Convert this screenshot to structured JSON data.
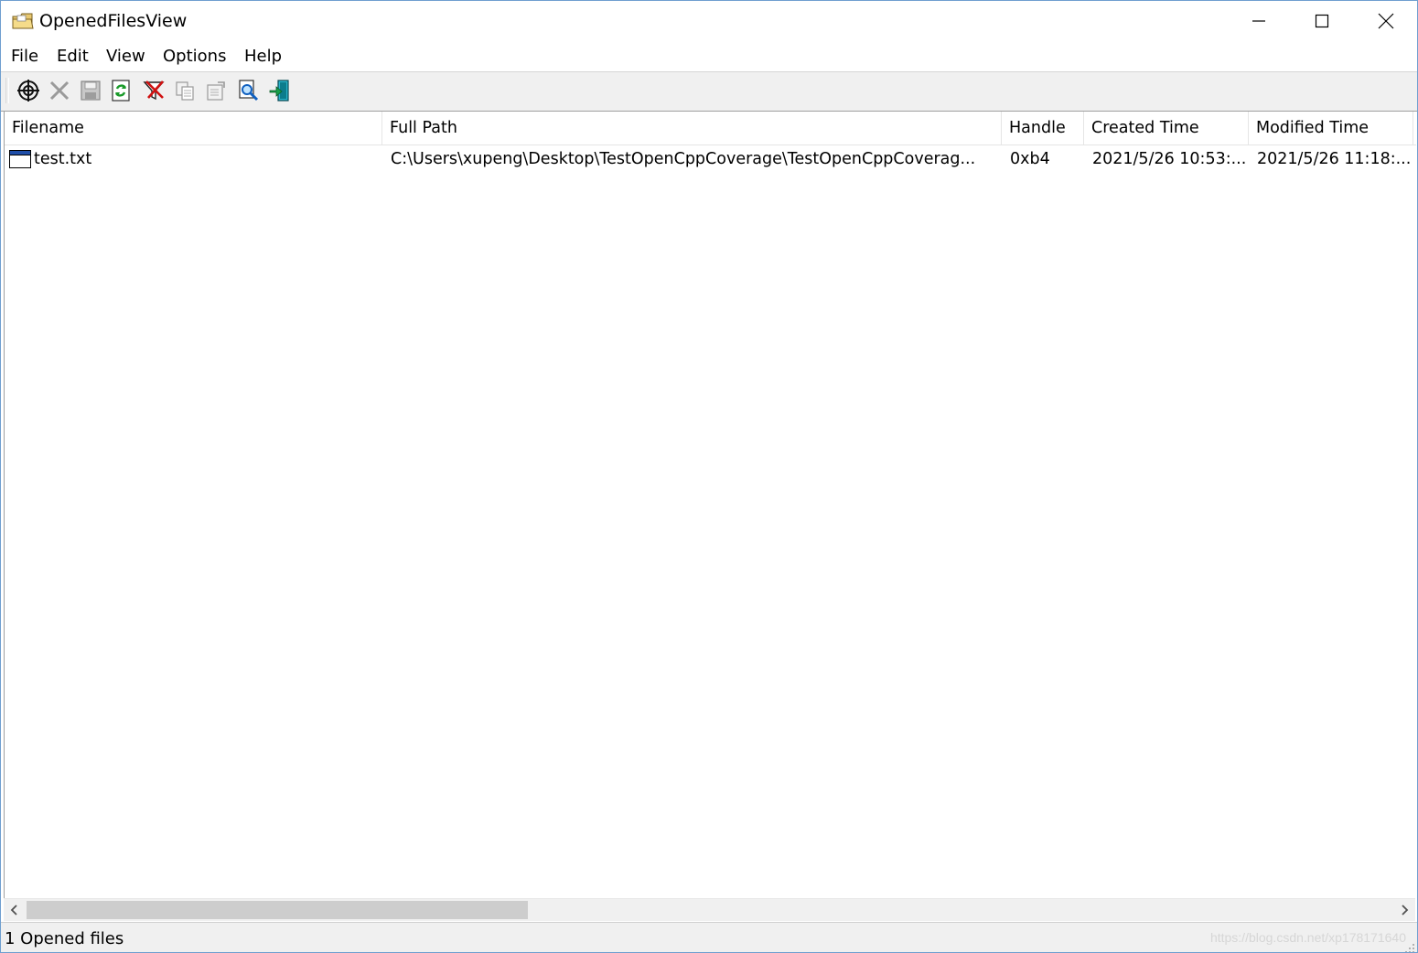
{
  "window": {
    "title": "OpenedFilesView",
    "buttons": {
      "minimize": "minimize",
      "maximize": "maximize",
      "close": "close"
    }
  },
  "menu": [
    "File",
    "Edit",
    "View",
    "Options",
    "Help"
  ],
  "toolbar": {
    "buttons": [
      "target-icon",
      "delete-icon",
      "save-icon",
      "refresh-icon",
      "filter-icon",
      "copy-icon",
      "properties-icon",
      "find-icon",
      "exit-icon"
    ]
  },
  "list": {
    "columns": [
      "Filename",
      "Full Path",
      "Handle",
      "Created Time",
      "Modified Time"
    ],
    "rows": [
      {
        "filename": "test.txt",
        "full_path": "C:\\Users\\xupeng\\Desktop\\TestOpenCppCoverage\\TestOpenCppCoverag...",
        "handle": "0xb4",
        "created": "2021/5/26 10:53:...",
        "modified": "2021/5/26 11:18:..."
      }
    ]
  },
  "status": {
    "text": "1 Opened files",
    "watermark": "https://blog.csdn.net/xp178171640"
  },
  "colors": {
    "accent": "#6f9fd0",
    "toolbar_bg": "#f0f0f0",
    "scroll_thumb": "#cdcdcd"
  }
}
